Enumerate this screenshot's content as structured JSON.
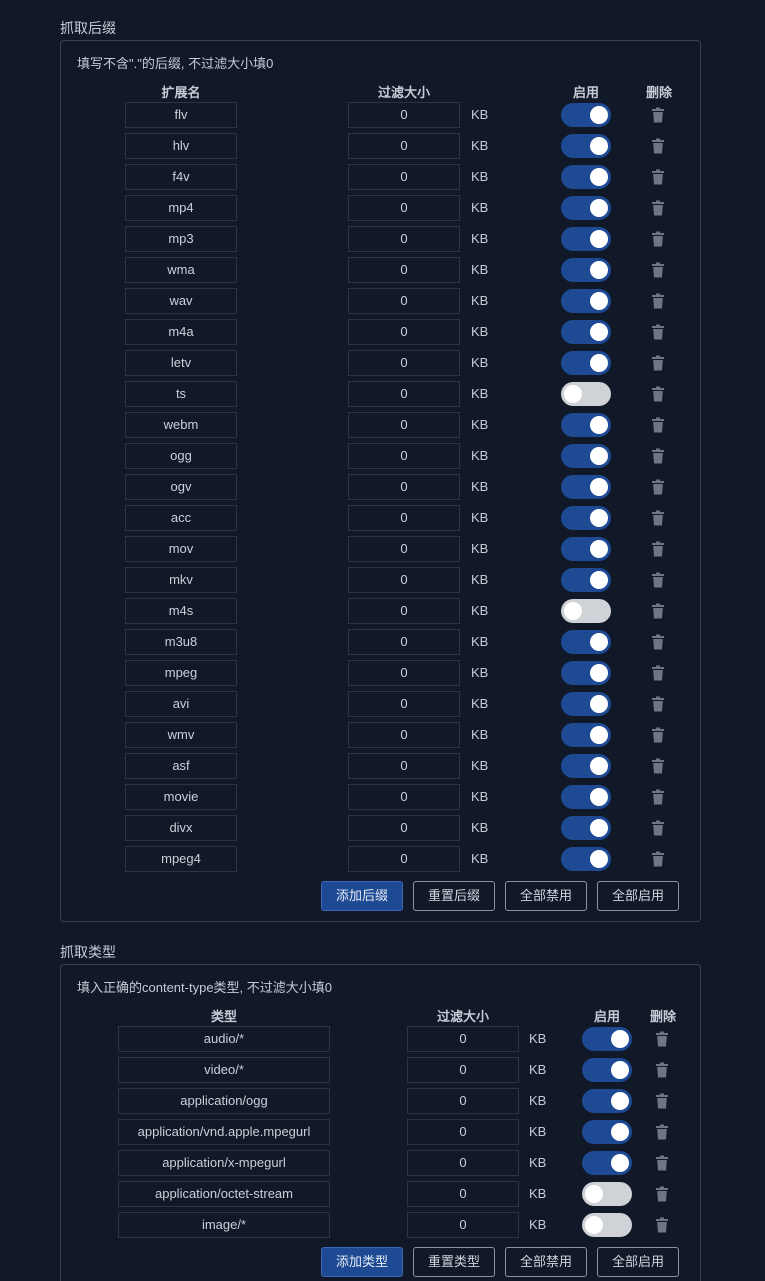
{
  "suffix": {
    "title": "抓取后缀",
    "hint": "填写不含\".\"的后缀, 不过滤大小填0",
    "col_ext": "扩展名",
    "col_size": "过滤大小",
    "col_enable": "启用",
    "col_delete": "删除",
    "unit": "KB",
    "rows": [
      {
        "ext": "flv",
        "size": "0",
        "enabled": true
      },
      {
        "ext": "hlv",
        "size": "0",
        "enabled": true
      },
      {
        "ext": "f4v",
        "size": "0",
        "enabled": true
      },
      {
        "ext": "mp4",
        "size": "0",
        "enabled": true
      },
      {
        "ext": "mp3",
        "size": "0",
        "enabled": true
      },
      {
        "ext": "wma",
        "size": "0",
        "enabled": true
      },
      {
        "ext": "wav",
        "size": "0",
        "enabled": true
      },
      {
        "ext": "m4a",
        "size": "0",
        "enabled": true
      },
      {
        "ext": "letv",
        "size": "0",
        "enabled": true
      },
      {
        "ext": "ts",
        "size": "0",
        "enabled": false
      },
      {
        "ext": "webm",
        "size": "0",
        "enabled": true
      },
      {
        "ext": "ogg",
        "size": "0",
        "enabled": true
      },
      {
        "ext": "ogv",
        "size": "0",
        "enabled": true
      },
      {
        "ext": "acc",
        "size": "0",
        "enabled": true
      },
      {
        "ext": "mov",
        "size": "0",
        "enabled": true
      },
      {
        "ext": "mkv",
        "size": "0",
        "enabled": true
      },
      {
        "ext": "m4s",
        "size": "0",
        "enabled": false
      },
      {
        "ext": "m3u8",
        "size": "0",
        "enabled": true
      },
      {
        "ext": "mpeg",
        "size": "0",
        "enabled": true
      },
      {
        "ext": "avi",
        "size": "0",
        "enabled": true
      },
      {
        "ext": "wmv",
        "size": "0",
        "enabled": true
      },
      {
        "ext": "asf",
        "size": "0",
        "enabled": true
      },
      {
        "ext": "movie",
        "size": "0",
        "enabled": true
      },
      {
        "ext": "divx",
        "size": "0",
        "enabled": true
      },
      {
        "ext": "mpeg4",
        "size": "0",
        "enabled": true
      }
    ],
    "buttons": {
      "add": "添加后缀",
      "reset": "重置后缀",
      "disable_all": "全部禁用",
      "enable_all": "全部启用"
    }
  },
  "type": {
    "title": "抓取类型",
    "hint": "填入正确的content-type类型, 不过滤大小填0",
    "col_type": "类型",
    "col_size": "过滤大小",
    "col_enable": "启用",
    "col_delete": "删除",
    "unit": "KB",
    "rows": [
      {
        "type": "audio/*",
        "size": "0",
        "enabled": true
      },
      {
        "type": "video/*",
        "size": "0",
        "enabled": true
      },
      {
        "type": "application/ogg",
        "size": "0",
        "enabled": true
      },
      {
        "type": "application/vnd.apple.mpegurl",
        "size": "0",
        "enabled": true
      },
      {
        "type": "application/x-mpegurl",
        "size": "0",
        "enabled": true
      },
      {
        "type": "application/octet-stream",
        "size": "0",
        "enabled": false
      },
      {
        "type": "image/*",
        "size": "0",
        "enabled": false
      }
    ],
    "buttons": {
      "add": "添加类型",
      "reset": "重置类型",
      "disable_all": "全部禁用",
      "enable_all": "全部启用"
    }
  },
  "colors": {
    "background": "#111828",
    "toggle_on": "#1e4a94",
    "toggle_off": "#cfd2d6",
    "primary_button": "#1e4a94"
  },
  "icons": {
    "delete": "trash-icon"
  }
}
